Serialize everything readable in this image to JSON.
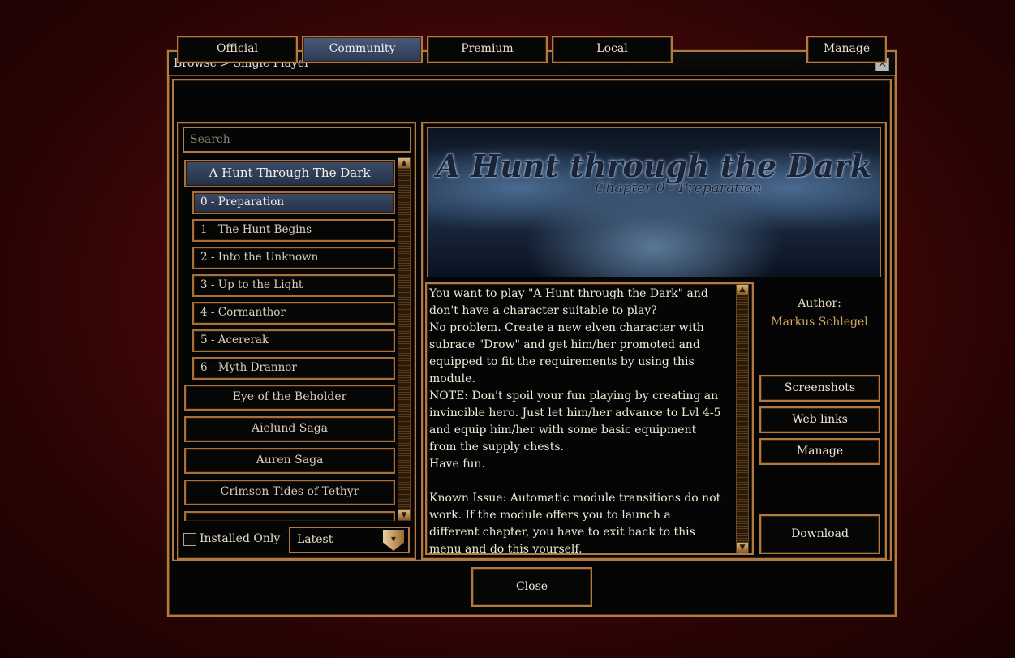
{
  "window": {
    "breadcrumb": "Browse  >  Single Player",
    "close_icon": "✕"
  },
  "tabs": [
    {
      "label": "Official",
      "active": false
    },
    {
      "label": "Community",
      "active": true
    },
    {
      "label": "Premium",
      "active": false
    },
    {
      "label": "Local",
      "active": false
    }
  ],
  "manage_tab": "Manage",
  "search": {
    "placeholder": "Search",
    "value": ""
  },
  "modules": {
    "selected_campaign": "A Hunt Through The Dark",
    "chapters": [
      "0  -  Preparation",
      "1  -  The  Hunt  Begins",
      "2  -  Into  the  Unknown",
      "3  -  Up  to  the  Light",
      "4  -  Cormanthor",
      "5  -  Acererak",
      "6  -  Myth  Drannor"
    ],
    "selected_chapter_index": 0,
    "others": [
      "Eye  of  the  Beholder",
      "Aielund  Saga",
      "Auren  Saga",
      "Crimson  Tides  of  Tethyr"
    ]
  },
  "installed_only": {
    "label": "Installed Only",
    "checked": false
  },
  "sort": {
    "value": "Latest"
  },
  "banner": {
    "title": "A Hunt through the Dark",
    "subtitle": "Chapter 0 - Preparation"
  },
  "description": "You want to play \"A Hunt through the Dark\" and\ndon't have a character suitable to play?\nNo problem. Create a new elven character with\nsubrace \"Drow\" and get him/her promoted and\nequipped to fit the requirements by using this\nmodule.\nNOTE: Don't spoil your fun playing by creating an\ninvincible hero. Just let him/her advance to Lvl 4-5\nand equip him/her with some basic equipment\nfrom the supply chests.\nHave fun.\n\nKnown Issue: Automatic module transitions do not\nwork. If the module offers you to launch a\ndifferent chapter, you have to exit back to this\nmenu and do this yourself.",
  "author": {
    "label": "Author:",
    "name": "Markus Schlegel"
  },
  "side_buttons": {
    "screenshots": "Screenshots",
    "web_links": "Web links",
    "manage": "Manage",
    "download": "Download"
  },
  "footer": {
    "close": "Close"
  },
  "icons": {
    "scroll_up": "▲",
    "scroll_down": "▼"
  },
  "colors": {
    "accent_border": "#b07a40",
    "selected_bg": "#2c3a54",
    "author_name": "#d8a860"
  }
}
